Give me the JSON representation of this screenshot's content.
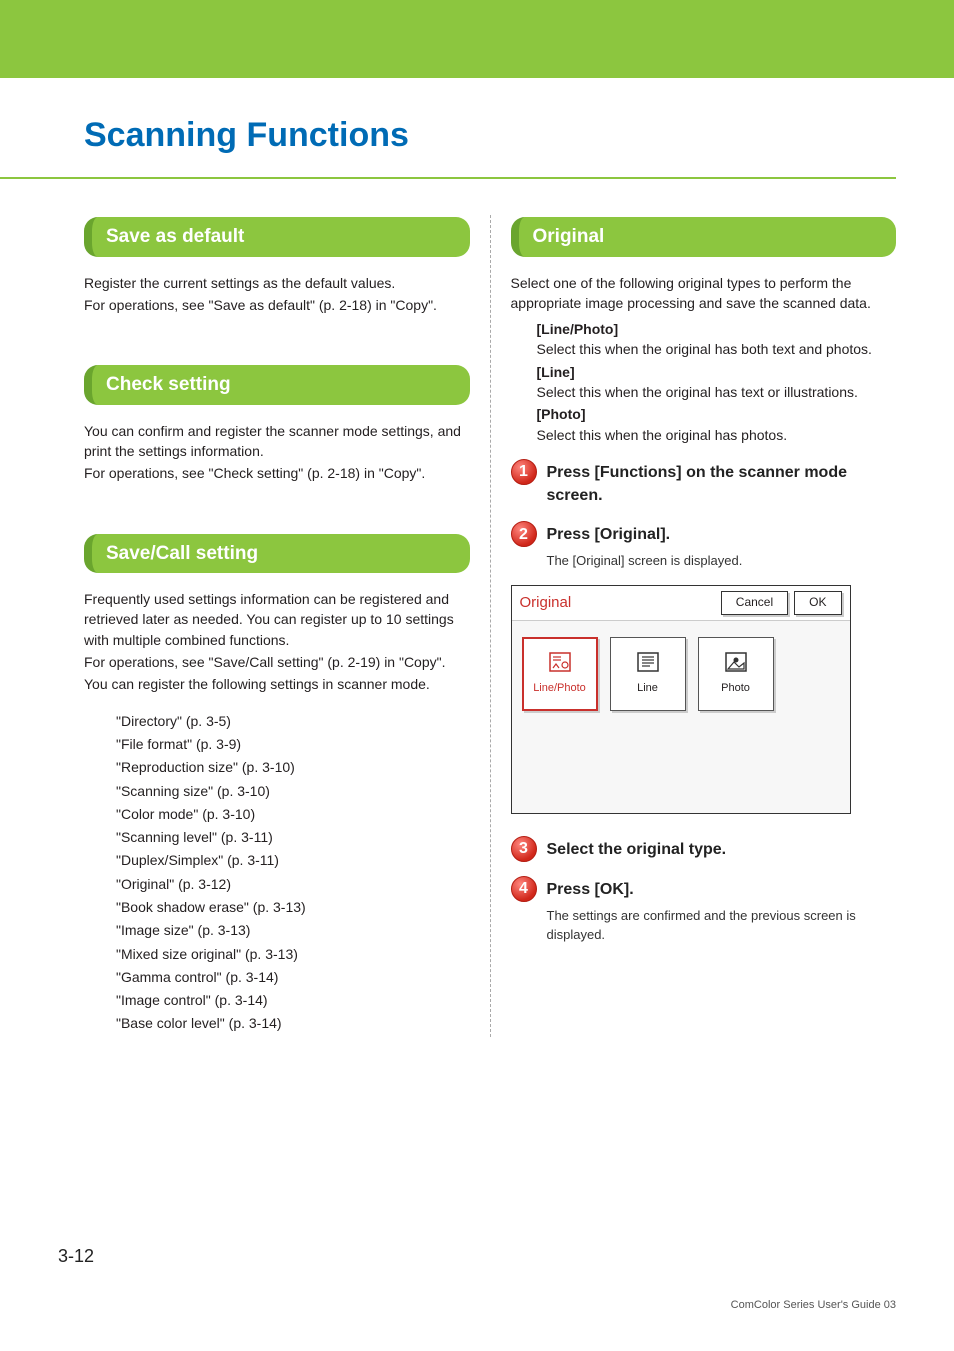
{
  "chapter_title": "Scanning Functions",
  "left": {
    "sec1": {
      "title": "Save as default",
      "p1": "Register the current settings as the default values.",
      "p2": "For operations, see \"Save as default\" (p. 2-18) in \"Copy\"."
    },
    "sec2": {
      "title": "Check setting",
      "p1": "You can confirm and register the scanner mode settings, and print the settings information.",
      "p2": "For operations, see \"Check setting\" (p. 2-18) in \"Copy\"."
    },
    "sec3": {
      "title": "Save/Call setting",
      "p1": "Frequently used settings information can be registered and retrieved later as needed. You can register up to 10 settings with multiple combined functions.",
      "p2": "For operations, see \"Save/Call setting\" (p. 2-19) in \"Copy\".",
      "p3": "You can register the following settings in scanner mode.",
      "items": [
        "\"Directory\" (p. 3-5)",
        "\"File format\" (p. 3-9)",
        "\"Reproduction size\" (p. 3-10)",
        "\"Scanning size\" (p. 3-10)",
        "\"Color mode\" (p. 3-10)",
        "\"Scanning level\" (p. 3-11)",
        "\"Duplex/Simplex\" (p. 3-11)",
        "\"Original\" (p. 3-12)",
        "\"Book shadow erase\" (p. 3-13)",
        "\"Image size\" (p. 3-13)",
        "\"Mixed size original\" (p. 3-13)",
        "\"Gamma control\" (p. 3-14)",
        "\"Image control\" (p. 3-14)",
        "\"Base color level\" (p. 3-14)"
      ]
    }
  },
  "right": {
    "sec": {
      "title": "Original",
      "intro": "Select one of the following original types to perform the appropriate image processing and save the scanned data.",
      "opts": {
        "lp_label": "[Line/Photo]",
        "lp_desc": "Select this when the original has both text and photos.",
        "l_label": "[Line]",
        "l_desc": "Select this when the original has text or illustrations.",
        "p_label": "[Photo]",
        "p_desc": "Select this when the original has photos."
      },
      "steps": {
        "s1": "Press [Functions] on the scanner mode screen.",
        "s2": "Press [Original].",
        "s2_desc": "The [Original] screen is displayed.",
        "s3": "Select the original type.",
        "s4": "Press [OK].",
        "s4_desc": "The settings are confirmed and the previous screen is displayed."
      },
      "screenshot": {
        "title": "Original",
        "cancel": "Cancel",
        "ok": "OK",
        "opt_lp": "Line/Photo",
        "opt_l": "Line",
        "opt_p": "Photo"
      }
    }
  },
  "page_number": "3-12",
  "footer": "ComColor Series User's Guide 03"
}
